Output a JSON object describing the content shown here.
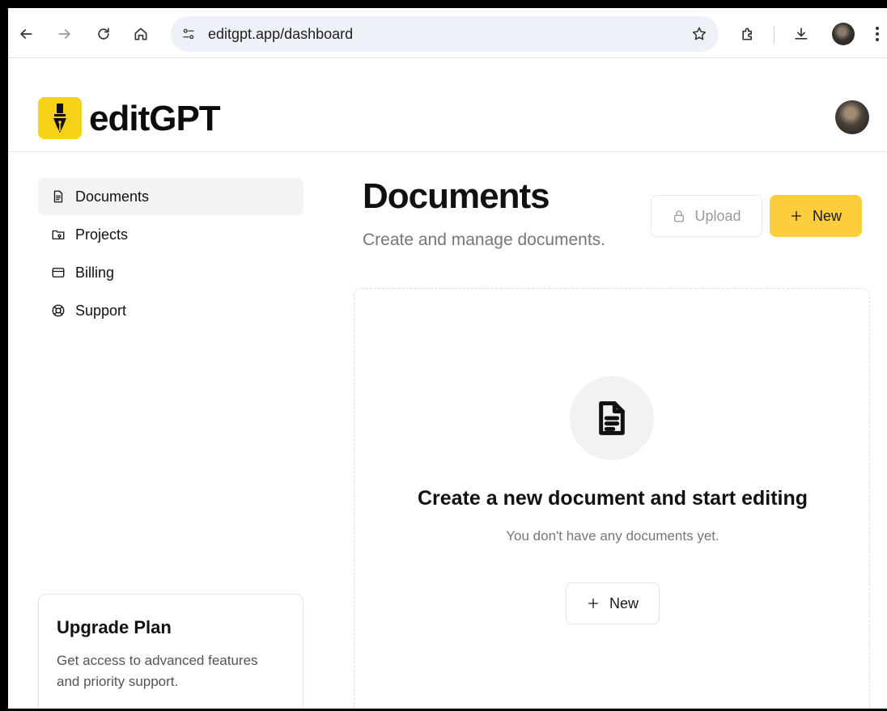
{
  "browser": {
    "url": "editgpt.app/dashboard",
    "icons": [
      "back-icon",
      "forward-icon",
      "reload-icon",
      "home-icon",
      "site-settings-icon",
      "bookmark-star-icon",
      "extensions-icon",
      "download-icon",
      "profile-avatar",
      "more-menu-icon"
    ]
  },
  "header": {
    "brand": "editGPT",
    "brand_color": "#f7d117"
  },
  "sidebar": {
    "items": [
      {
        "label": "Documents",
        "icon": "document-icon",
        "active": true
      },
      {
        "label": "Projects",
        "icon": "folder-icon",
        "active": false
      },
      {
        "label": "Billing",
        "icon": "credit-card-icon",
        "active": false
      },
      {
        "label": "Support",
        "icon": "lifebuoy-icon",
        "active": false
      }
    ],
    "upgrade": {
      "title": "Upgrade Plan",
      "description": "Get access to advanced features and priority support."
    }
  },
  "main": {
    "title": "Documents",
    "subtitle": "Create and manage documents.",
    "upload_label": "Upload",
    "new_label": "New",
    "accent": "#fccd3c",
    "empty_state": {
      "title": "Create a new document and start editing",
      "description": "You don't have any documents yet.",
      "new_label": "New"
    }
  }
}
